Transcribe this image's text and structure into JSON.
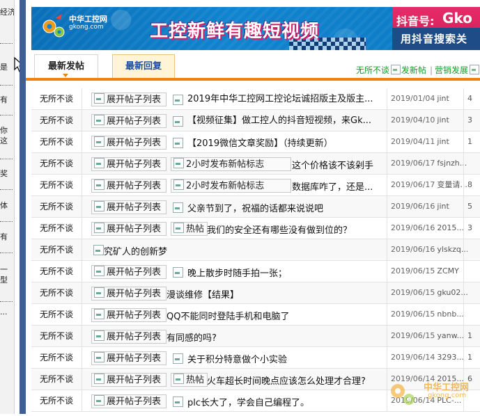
{
  "sidebar": {
    "fragments": [
      "经济采",
      "是",
      "有",
      "你这",
      "奖",
      "体",
      "有",
      "一型",
      "..."
    ]
  },
  "banner": {
    "logo_cn": "中华工控网",
    "logo_en": "gkong.com",
    "headline": "工控新鲜有趣短视频",
    "douyin_label": "抖音号:",
    "douyin_id": "Gko",
    "slogan": "用抖音搜索关"
  },
  "tabs": {
    "latest": "最新发帖",
    "reply": "最新回复",
    "actions": [
      "无所不谈",
      "发新帖",
      "营销发展",
      ""
    ]
  },
  "common": {
    "expand_label": "展开帖子列表",
    "hot_label": "热帖",
    "new_badge_label": "2小时发布新帖标志"
  },
  "threads": [
    {
      "forum": "无所不谈",
      "title": "2019年中华工控网工控论坛诚招版主及版主...",
      "date": "2019/01/04",
      "author": "jint",
      "count": "4"
    },
    {
      "forum": "无所不谈",
      "title": "【视频征集】做工控人的抖音短视频，来Gk...",
      "date": "2019/04/10",
      "author": "jint",
      "count": "3"
    },
    {
      "forum": "无所不谈",
      "title": "【2019微信文章奖励】（持续更新）",
      "date": "2019/04/11",
      "author": "jint",
      "count": "1"
    },
    {
      "forum": "无所不谈",
      "title": "这个价格该不该剁手",
      "date": "2019/06/17",
      "author": "fsjnzh...",
      "count": ""
    },
    {
      "forum": "无所不谈",
      "title": "数据库咋了，还是...",
      "date": "2019/06/17",
      "author": "变量请...",
      "count": "8"
    },
    {
      "forum": "无所不谈",
      "title": "父亲节到了，祝福的话都来说说吧",
      "date": "2019/06/16",
      "author": "jint",
      "count": "5"
    },
    {
      "forum": "无所不谈",
      "title": "我们的安全还有哪些没有做到位的？",
      "date": "2019/06/16",
      "author": "2015...",
      "count": "3"
    },
    {
      "forum": "无所不谈",
      "title": "究矿人的创新梦",
      "date": "2019/06/16",
      "author": "ylskzq...",
      "count": ""
    },
    {
      "forum": "无所不谈",
      "title": "晚上散步时随手拍一张；",
      "date": "2019/06/15",
      "author": "ZCMY",
      "count": ""
    },
    {
      "forum": "无所不谈",
      "title": "漫谈维修【结果】",
      "date": "2019/06/15",
      "author": "gku02...",
      "count": ""
    },
    {
      "forum": "无所不谈",
      "title": "QQ不能同时登陆手机和电脑了",
      "date": "2019/06/15",
      "author": "nbnb...",
      "count": ""
    },
    {
      "forum": "无所不谈",
      "title": "有同感的吗?",
      "date": "2019/06/15",
      "author": "yanw...",
      "count": "1"
    },
    {
      "forum": "无所不谈",
      "title": "关于积分特意做个小实验",
      "date": "2019/06/14",
      "author": "3293...",
      "count": "1"
    },
    {
      "forum": "无所不谈",
      "title": "火车超长时间晚点应该怎么处理才合理?",
      "date": "2019/06/14",
      "author": "2015...",
      "count": "6"
    },
    {
      "forum": "无所不谈",
      "title": "plc长大了，学会自己编程了。",
      "date": "2019/06/14",
      "author": "PLC-...",
      "count": ""
    }
  ],
  "watermark": {
    "cn": "中华工控网",
    "en": "gkong.com"
  },
  "colors": {
    "accent_orange": "#ef7f12",
    "tab_blue": "#1b4da2",
    "action_green": "#159a2a",
    "sidebar_blue": "#3f5f8e"
  }
}
